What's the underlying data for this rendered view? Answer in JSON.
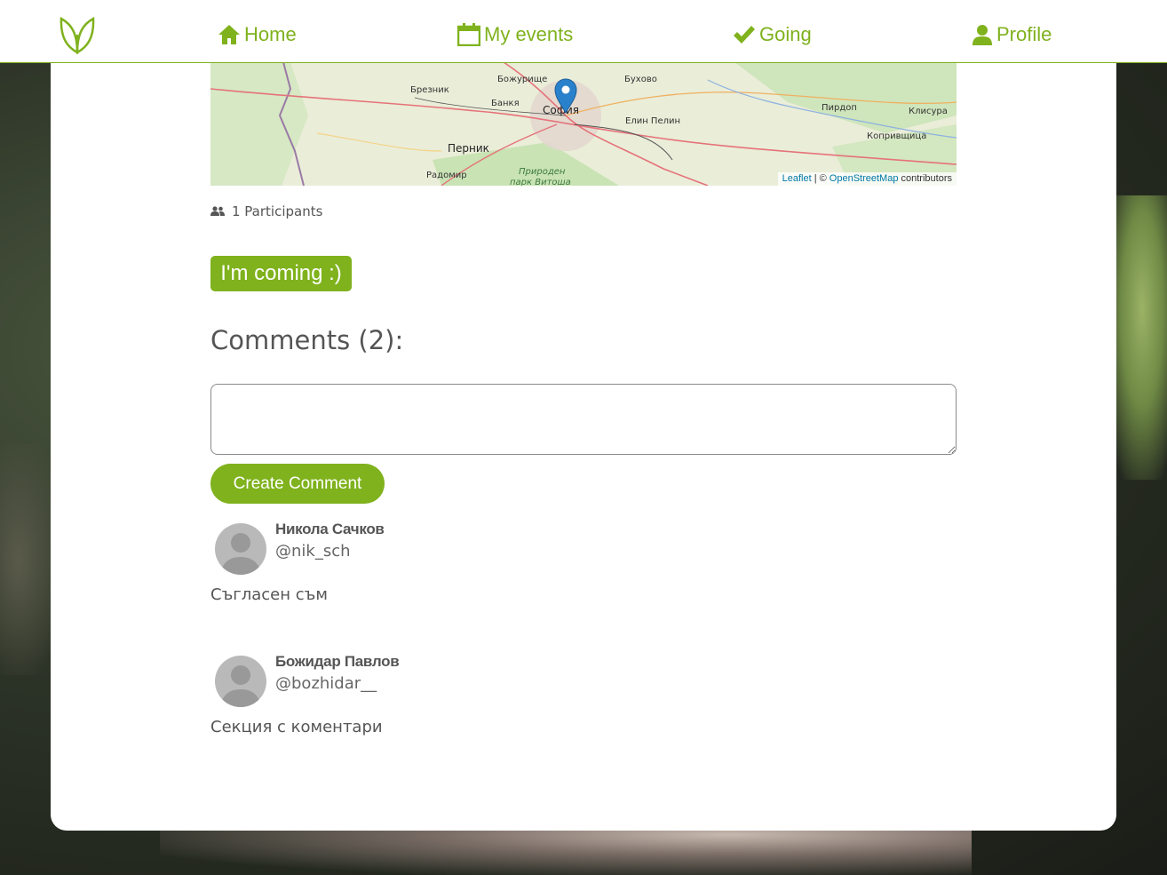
{
  "nav": {
    "logo_icon": "leaf-logo-icon",
    "items": [
      {
        "label": "Home",
        "icon": "home-icon"
      },
      {
        "label": "My events",
        "icon": "calendar-icon"
      },
      {
        "label": "Going",
        "icon": "checkmark-icon"
      },
      {
        "label": "Profile",
        "icon": "user-icon"
      }
    ]
  },
  "colors": {
    "accent": "#7fb21d",
    "text": "#555555",
    "card_bg": "#ffffff"
  },
  "map": {
    "places": [
      "Брезник",
      "Божурище",
      "Бухово",
      "Банкя",
      "София",
      "Елин Пелин",
      "Пирдоп",
      "Клисура",
      "Копривщица",
      "Перник",
      "Радомир",
      "Природен",
      "парк Витоша"
    ],
    "attribution": {
      "leaflet": "Leaflet",
      "separator": "| ©",
      "osm": "OpenStreetMap",
      "suffix": "contributors"
    }
  },
  "event": {
    "participants_text": "1 Participants",
    "coming_button": "I'm coming :)"
  },
  "comments": {
    "title": "Comments (2):",
    "input_value": "",
    "create_button": "Create Comment",
    "items": [
      {
        "name": "Никола Сачков",
        "handle": "@nik_sch",
        "text": "Съгласен съм"
      },
      {
        "name": "Божидар Павлов",
        "handle": "@bozhidar__",
        "text": "Секция с коментари"
      }
    ]
  }
}
